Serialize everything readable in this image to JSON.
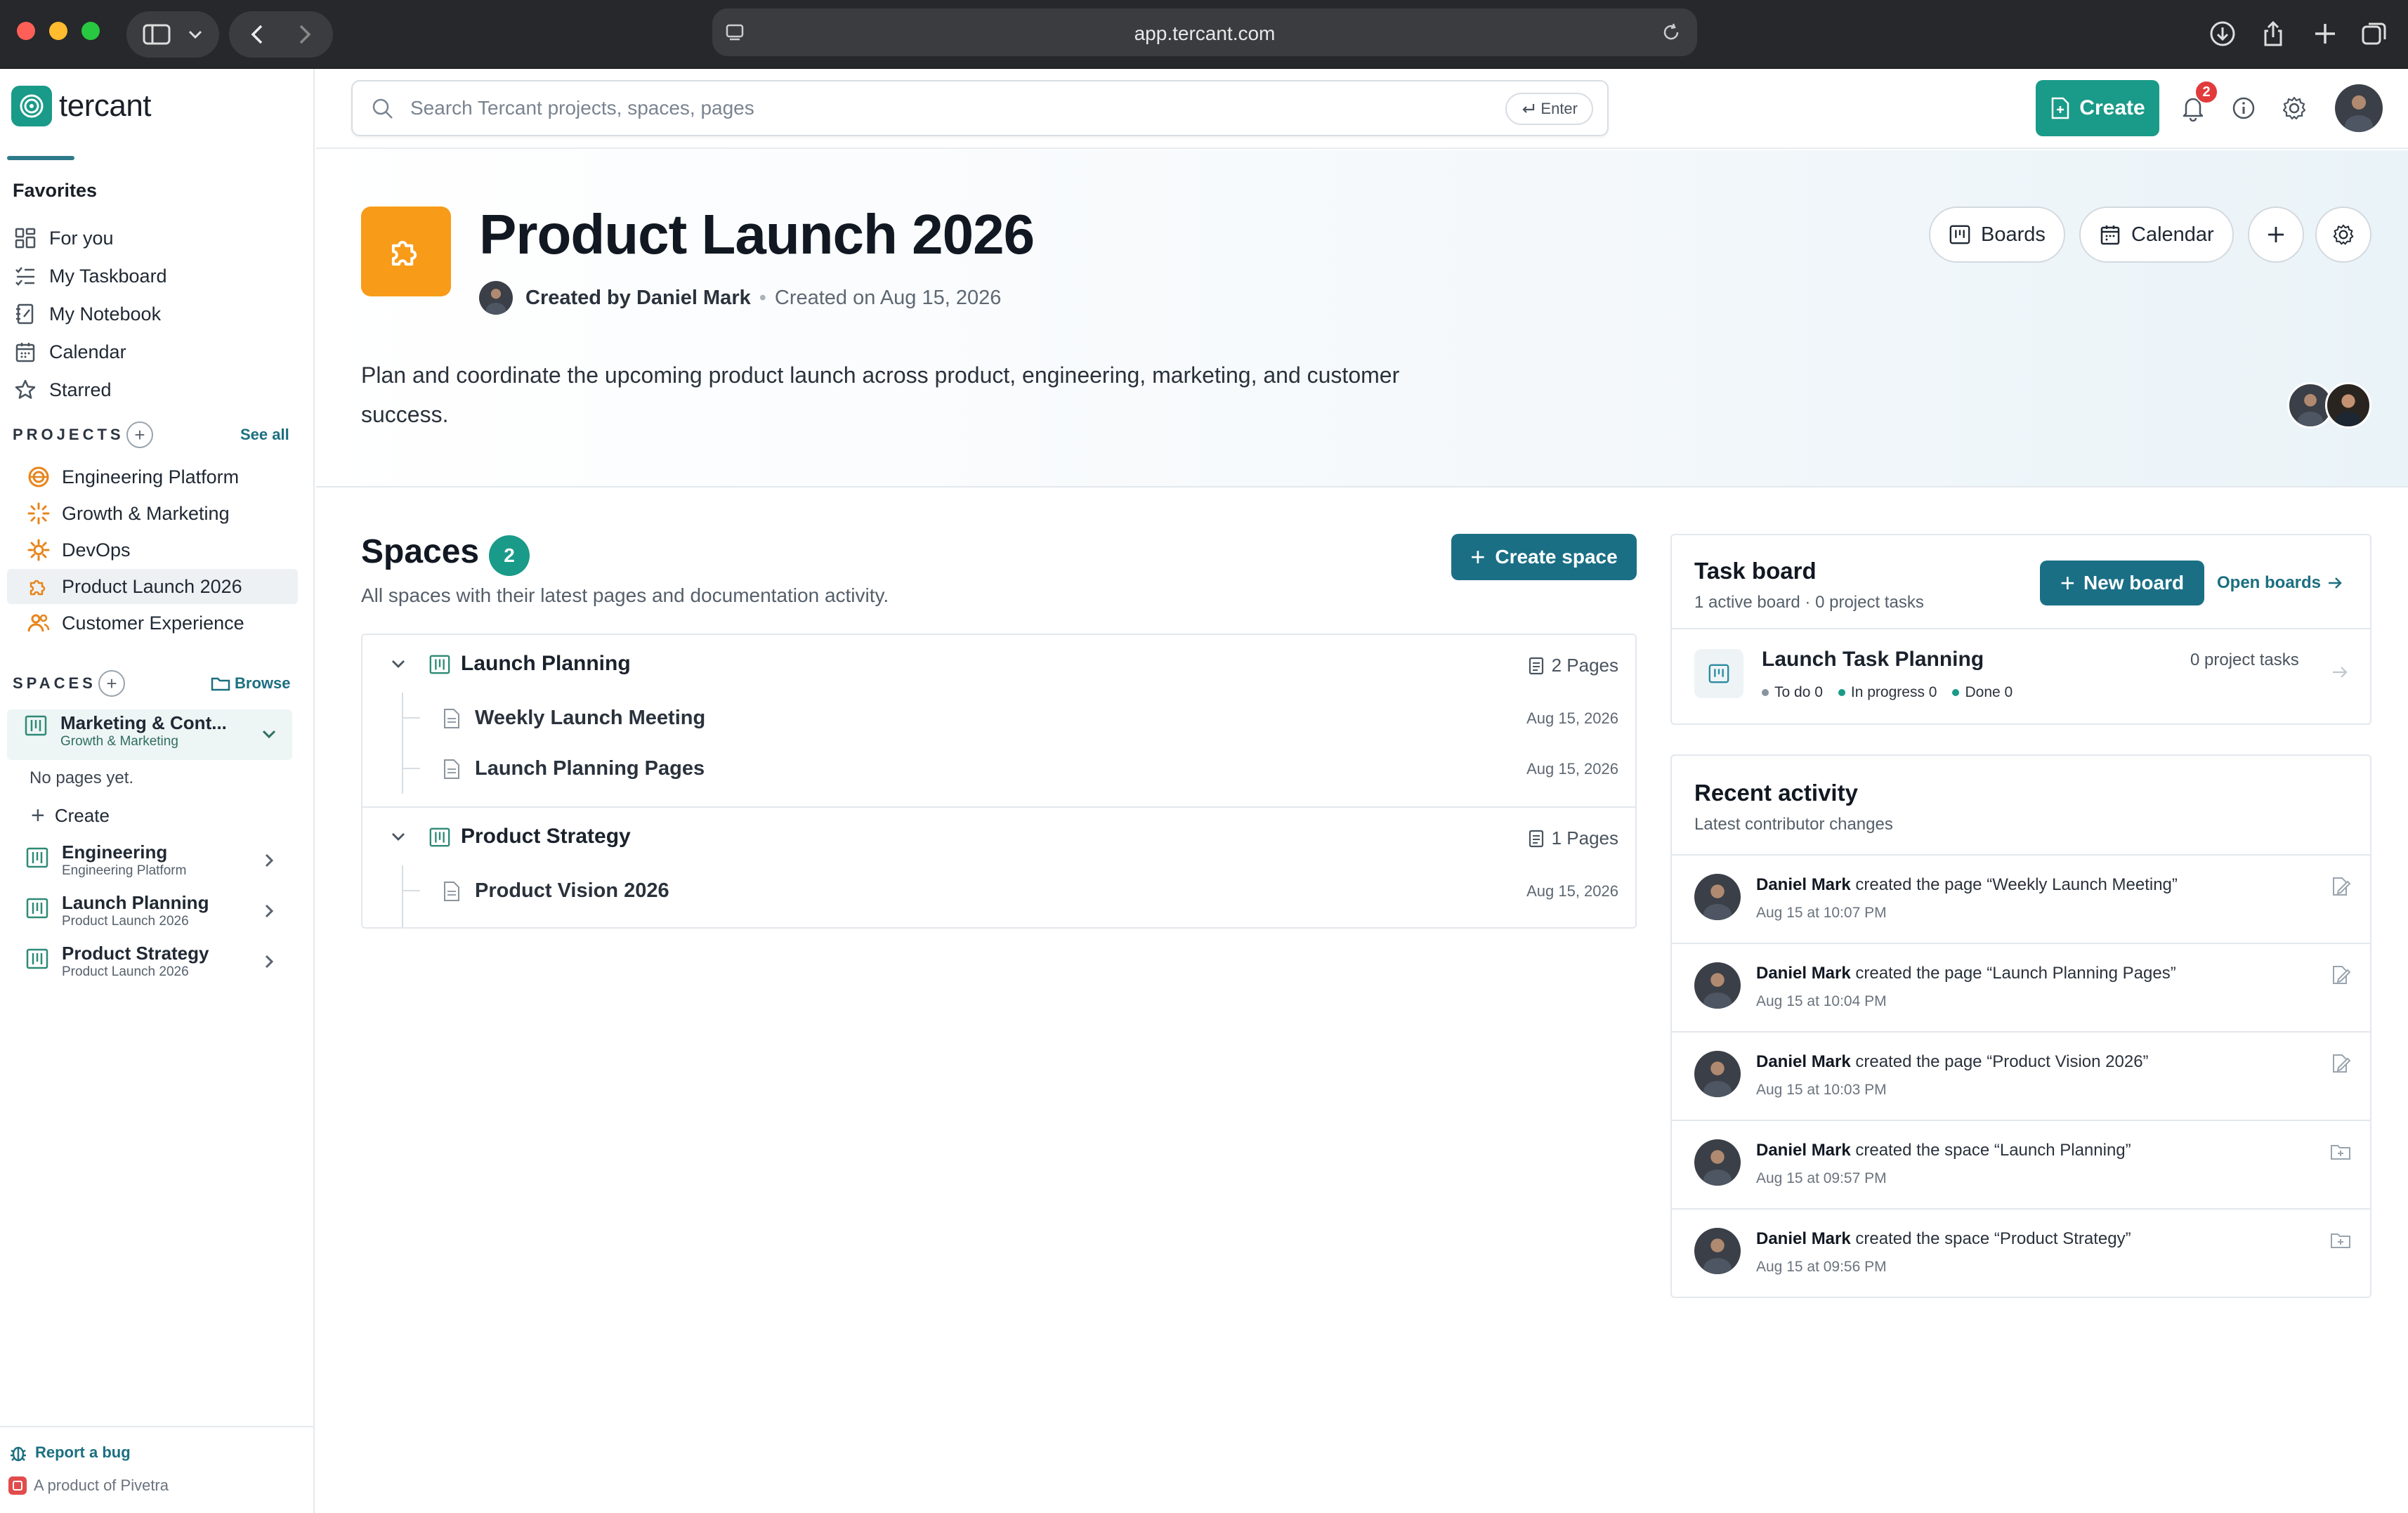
{
  "browser": {
    "url": "app.tercant.com"
  },
  "app": {
    "logo_text": "tercant",
    "brand_color": "#1a9a88",
    "accent_color": "#1a6f85"
  },
  "sidebar": {
    "favorites_heading": "Favorites",
    "favorites": [
      {
        "label": "For you",
        "icon": "grid-icon"
      },
      {
        "label": "My Taskboard",
        "icon": "checklist-icon"
      },
      {
        "label": "My Notebook",
        "icon": "notebook-icon"
      },
      {
        "label": "Calendar",
        "icon": "calendar-icon"
      },
      {
        "label": "Starred",
        "icon": "star-icon"
      }
    ],
    "projects_label": "PROJECTS",
    "see_all": "See all",
    "projects": [
      {
        "label": "Engineering Platform",
        "color": "#e8841a"
      },
      {
        "label": "Growth & Marketing",
        "color": "#e8841a"
      },
      {
        "label": "DevOps",
        "color": "#e8841a"
      },
      {
        "label": "Product Launch 2026",
        "color": "#e8841a"
      },
      {
        "label": "Customer Experience",
        "color": "#e8841a"
      }
    ],
    "spaces_label": "SPACES",
    "browse": "Browse",
    "active_space": {
      "title": "Marketing & Cont...",
      "subtitle": "Growth & Marketing"
    },
    "no_pages": "No pages yet.",
    "create": "Create",
    "spaces": [
      {
        "title": "Engineering",
        "subtitle": "Engineering Platform"
      },
      {
        "title": "Launch Planning",
        "subtitle": "Product Launch 2026"
      },
      {
        "title": "Product Strategy",
        "subtitle": "Product Launch 2026"
      }
    ],
    "report_bug": "Report a bug",
    "product_of": "A product of Pivetra"
  },
  "topbar": {
    "search_placeholder": "Search Tercant projects, spaces, pages",
    "enter_chip": "Enter",
    "create_label": "Create",
    "notification_count": "2"
  },
  "project": {
    "title": "Product Launch 2026",
    "created_by": "Created by Daniel Mark",
    "created_on": "Created on Aug 15, 2026",
    "description": "Plan and coordinate the upcoming product launch across product, engineering, marketing, and customer success.",
    "boards_btn": "Boards",
    "calendar_btn": "Calendar"
  },
  "spaces_section": {
    "title": "Spaces",
    "count": "2",
    "subtitle": "All spaces with their latest pages and documentation activity.",
    "create_btn": "Create space",
    "groups": [
      {
        "name": "Launch Planning",
        "pages_count": "2 Pages",
        "pages": [
          {
            "name": "Weekly Launch Meeting",
            "date": "Aug 15, 2026"
          },
          {
            "name": "Launch Planning Pages",
            "date": "Aug 15, 2026"
          }
        ]
      },
      {
        "name": "Product Strategy",
        "pages_count": "1 Pages",
        "pages": [
          {
            "name": "Product Vision 2026",
            "date": "Aug 15, 2026"
          }
        ]
      }
    ]
  },
  "task_board": {
    "title": "Task board",
    "subtitle": "1 active board · 0 project tasks",
    "new_board": "New board",
    "open_boards": "Open boards",
    "board": {
      "name": "Launch Task Planning",
      "tasks": "0 project tasks",
      "todo": "To do 0",
      "in_progress": "In progress 0",
      "done": "Done 0",
      "todo_color": "#8a949e",
      "in_progress_color": "#1a9a88",
      "done_color": "#1a9a88"
    }
  },
  "recent_activity": {
    "title": "Recent activity",
    "subtitle": "Latest contributor changes",
    "items": [
      {
        "user": "Daniel Mark",
        "action": " created the page “Weekly Launch Meeting”",
        "time": "Aug 15 at 10:07 PM",
        "icon": "edit-page-icon"
      },
      {
        "user": "Daniel Mark",
        "action": " created the page “Launch Planning Pages”",
        "time": "Aug 15 at 10:04 PM",
        "icon": "edit-page-icon"
      },
      {
        "user": "Daniel Mark",
        "action": " created the page “Product Vision 2026”",
        "time": "Aug 15 at 10:03 PM",
        "icon": "edit-page-icon"
      },
      {
        "user": "Daniel Mark",
        "action": " created the space “Launch Planning”",
        "time": "Aug 15 at 09:57 PM",
        "icon": "folder-plus-icon"
      },
      {
        "user": "Daniel Mark",
        "action": " created the space “Product Strategy”",
        "time": "Aug 15 at 09:56 PM",
        "icon": "folder-plus-icon"
      }
    ]
  }
}
